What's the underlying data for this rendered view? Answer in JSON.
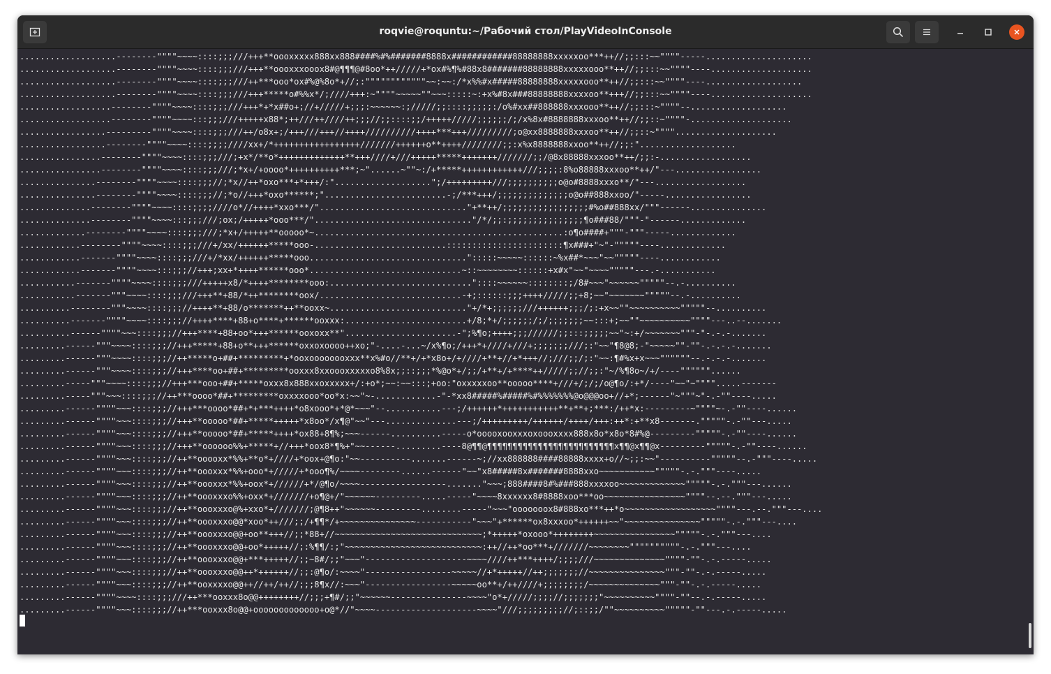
{
  "window": {
    "title": "roqvie@roquntu:~/Рабочий стол/PlayVideoInConsole"
  },
  "titlebar": {
    "new_tab_icon": "new-tab-icon",
    "search_icon": "search-icon",
    "menu_icon": "hamburger-menu-icon",
    "minimize_icon": "minimize-icon",
    "maximize_icon": "maximize-icon",
    "close_icon": "close-icon"
  },
  "colors": {
    "terminal_bg": "#2d2b33",
    "titlebar_bg": "#2b2b2b",
    "text": "#e9e9e9",
    "close_accent": "#e95420"
  },
  "terminal": {
    "lines": [
      "...................--------\"\"\"\"~~~~::::;;;///+++**oooxxxxx888xx888####%#%#######8888x############88888888xxxxxoo***++//;;:::~~\"\"\"\"-----.....................",
      "...................--------\"\"\"\"~~~~::::;;;///+++**oooxxxooox8#@¶¶¶@#8oo*++/////+*ox#%¶%#88x8#######88888888xxxxxooo**++//;;:::~~\"\"\"\"----....................",
      "...................--------\"\"\"\"~~~~::::;;;///++***ooo*ox#%@%8o*+//;:\"\"\"\"\"\"\"\"\"\"\"\"~~:~~:/*x%%#x#####88888888xxxxxooo**++//;;:::~~\"\"\"\"----...................",
      "...................--------\"\"\"\"~~~~::::;;;///+++*****o#%%x*/;////+++:~\"\"\"\"~~~~~\"\"~~~:::::~:+x%#8x###88888888xxxxoo**+++//;;:::~~\"\"\"\"----....................",
      "..................--------\"\"\"\"~~~~::::;;;///+++*+*x##o+;//+/////+;;;:~~~~~~:;/////;;::::;;;;;:/o%#xx##888888xxxooo**++//;;:::~\"\"\"\"--...................",
      "..................--------\"\"\"\"~~~~:::;;;///+++++x88*;++///++////++;;;//;;::::;;/+++++/////;;;;;;/;/x%8x#8888888xxxoo**++//;;::~\"\"\"\"-....................",
      ".................---------\"\"\"\"~~~~::::;;;///++/o8x+;/+++///+++//++++//////////++++***+++/////////;o@xx8888888xxxoo**++//;;::~\"\"\"\"....................",
      ".................--------\"\"\"\"~~~~::::;;;;////xx+/*+++++++++++++++++///////++++++o**++++////////;;:x%x8888888xxoo**++//;;:\"...................",
      "................--------\"\"\"\"~~~~::::;;;///;+x*/**o*+++++++++++++**+++////+///+++++*****+++++++///////;;/@8x88888xxxoo**++/;;:-..................",
      "................--------\"\"\"\"~~~~::::;;;///;*x+/+oooo*++++++++++***;~\"......~\"\"~:/+*****++++++++++++///;;;;:8%o88888xxxoo**++/\"---.................",
      "...............--------\"\"\"\"~~~~::::;;;//;*x//++*oxo***+*+++/:\"...................\";/+++++++++///;;;;;;;;;;o@o#8888xxxo**/\"---..................",
      "...............--------\"\"\"\"~~~~::::;;;//;*o//+++*oxo******;\"........................-;/***+++/;;;;;;;;;;;;;;o@o##888xxoo/\"-----.................",
      "..............--------\"\"\"\"~~~~::::;;;;////o*//++++*xxo***/\".............................\"+**++/;;;;;;;;;;;;;;;;;#%o##888xx/\"\"\"------...............",
      "..............--------\"\"\"\"~~~~:::;;;///;ox;/+++++*ooo***/\"...............................\"/*/;;:;;;;;;;;;;;;;;;¶o###88/\"\"\"-\"------.............",
      ".............--------\"\"\"\"~~~~::::;;;///;*x+/+++++**ooooo*~.................................................:o¶o####+\"\"\"-\"\"\"-----.............",
      "............--------\"\"\"\"~~~~::::;;;///+/xx/++++++*****ooo-..........................:::::::::::::::::::::::¶x###+\"~\"-\"\"\"\"\"----.............",
      "............-------\"\"\"\"~~~~::::;;;///+/*xx/++++++*****ooo...............................\":::::~~~~~::::::~%x##*~~~\"~~\"\"\"\"\"----............",
      "............-------\"\"\"\"~~~~:::;;;//+++;xx+*++++******ooo*..............................~::~~~~~~~~::::::+x#x\"~~\"~~~~\"\"\"\"\"---.-...........",
      "...........-------\"\"\"\"~~~~::::;;;///+++++x8/*++++********ooo:............................\"::::~~~~~~::::::::;/8#~~~\"~~~~~~\"\"\"\"\"--.-..........",
      "...........-------\"\"\"~~~~::::;;;///+++**+88/*++********oox/............................-+;::::::;;;++++/////;;+8;~~\"~~~~~~~\"\"\"\"\"--.-..........",
      "..........--------\"\"\"~~~~::::;;;//++++**+88/o*******++**ooxx~...........................\"+/*+;;;;;;///++++++;;;/;:+x~~\"\"~~~~~~~~~~\"\"\"\"\"--..........",
      "..........-------\"\"\"\"~~~~::::;;;//++++****+88+o****+******ooxxx:........................+/8;*+/;;;;;;/;/;;;;;;;~~:::+;~~\"\"~~~~~~~~~~\"\"\"\"---..--.......",
      "..........------\"\"\"\"~~~::::;;;//+++****+88+oo*+++******ooxoxx**\"......................-\";%¶o;++++;;;//////;;:::;;;;;~~\"~:+/~~~~~~~\"\"\"-\"-.-.-.......",
      ".........------\"\"\"~~~~::::;;;//+++*****+88+o**+++******oxxoxoooo++xo;\"-....-...~/x%¶o;/+++*+////+///+;;;;;;;///;:\"~~\"¶8@8;-\"~~~~~\"\"-\"\"-.-.-.-.......",
      ".........------\"\"\"~~~~::::;;;//++*****o+##+*********+*ooxoooooooxxx**x%#o//**+/+*x8o+/+////+**+//+*+++//;///;;/;:\"~~:¶#%x+x~~~\"\"\"\"\"\"--.-.-.-.......",
      ".........------\"\"\"~~~~::::;;;//+++****oo+##+*********ooxxx8xxoooxxxxxo8%8x;;::;;;*%@o*+/;;/+**+/+****++/////;;//;;:\"~/%¶8o~/+/----\"\"\"\"\"\"......",
      ".........-----\"\"\"~~~~::::;;;//+++***ooo+##+*****oxxx8x888xxoxxxxx+/:+o*;~~:~~:::;+oo:\"oxxxxxoo**ooooo****+///+/;/;/o@¶o/:+*/----\"~~\"~\"\"\"\".....-------",
      ".........-----\"\"\"~~~::::;;;//++***oooo*##+*********oxxxxooo*oo*x:~~\"~-............-\"-*xx8#####%#####%#%%%%%%%@o@@@oo+//+*;------\"~\"\"\"~\"-.-\"\"----.....",
      ".........------\"\"\"\"~~~::::;;;//+++***oooo*##+*+***++++*o8xooo*+*@*~~~\"--...........---;/++++++*+++++++++++**+**+;***:/++*x:---------~\"\"\"\"~-.-\"\"----......",
      ".........------\"\"\"\"~~~::::;;;//+++**ooooo*##+*****+++++*x8oo*/x¶@\"~~\"---..............---;/+++++++++/++++++/++++/+++:++*:+**x8-------.\"\"\"\"\"-.-\"\"---.....",
      ".........------\"\"\"\"~~~::::;;;//+++**ooooo*##+*****++++*ox88+8¶%;~~~------..........-----o*ooooxooxxxoxoooxxxx888x8o*x8o*8#%@---------\"\"\"\"\"-.-\"\"----......",
      ".........------\"\"\"\"~~~::::;;;//+++**oooooo%%+*****+//+++*oox8*¶%+\"~~------.........----8@¶¶@¶¶¶¶¶¶¶¶¶¶¶¶¶¶¶¶¶¶¶¶¶¶¶¶¶x¶¶@x¶¶@x---------\"\"\"\"\"-.-\"\"----......",
      ".........------\"\"\"\"~~~::::;;;//++**ooooxx*%%+**o*+////+*oox+@¶o:\"~~----------.......------~;//xx888888####88888xxxx+o//~;;:~~\"----------\"\"\"\"\"--.-\"\"\"----.....",
      ".........------\"\"\"\"~~~::::;;;//++**oooxxx*%%+ooo*+/////+*ooo¶%/~~~~--------......------\"~~\"x8#####8x#######8888xxo~~~~~~~~~~~\"\"\"\"\"-.-.\"\"\"----.....",
      ".........------\"\"\"\"~~~::::;;;//++**oooxxx*%%+oox*+//////+*/@¶o/~~~~-----------------.......\"~~~;888####8#%###888xxxxoo~~~~~~~~~~~~~\"\"\"\"\"-.-.\"\"\"---......",
      ".........------\"\"\"\"~~~::::;;;//++**oooxxxo%%+oxx*+///////+o¶@+/\"~~~~~~---------.....-----\"~~~~8xxxxxx8#8888xoo***oo~~~~~~~~~~~~~~~~\"\"\"\"--.--.\"\"\"---.....",
      ".........------\"\"\"\"~~~::::;;;//++**oooxxxo@%+xxo*+///////;@¶8++\"~~~~~~---------........-----\"~~~\"ooooooox8#888xo***++*o~~~~~~~~~~~~~~~~~~\"\"\"\"---.--.\"\"\"---....",
      ".........------\"\"\"\"~~~::::;;;//++**oooxxxo@@*xoo*++///;;/+¶¶*/+~~~~~~~~~~~~~~~-----------\"~~~\"+******ox8xxxoo*++++++~~\"~~~~~~~~~~~~~~~\"\"\"\"\"-.-.\"\"\"---....",
      ".........------\"\"\"\"~~~::::;;;//++**oooxxxo@@+oo**+++//;;*88+//~~~~~~~~~~~~~~~~~~~~~~~~~~~~~;*+++++*oxooo*++++++++~~~~~~~~~~~~~~~~\"\"\"\"\"-.-.\"\"\"---....",
      ".........------\"\"\"\"~~~::::;;;//++**oooxxxo@@+oo*+++++//;:%¶¶/:;\"~~~~~~~~~~~~~~~~~~~~~~~~~~~:++//++*oo***+///////~~~~~~~~\"\"\"\"\"\"\"\"\"\"-.-.\"\"\"---....",
      ".........------\"\"\"\"~~~::::;;;//++**oooxxxo@@+***+++++//;;~8#/;;\"~~~\"--------------------~~~~////++***++++/;;;;///~~~~~~~~~~~~~~\"\"\"\"-\"\"-.-.-----.....",
      ".........------\"\"\"\"~~~::::;;;//++**oooxxxo@@++*++++++//;;:@¶o/:~~~~\"-----------------~~~~~//+*+++++//++;;;;;;;//~~~~~~~~~~~~~~~\"\"\"-\"\"-.-.-----.....",
      ".........------\"\"\"\"~~~::::;;;//++**ooxxxxo@@++//++/++//;;;8¶x//:~~~\"-----------------~~~~~oo**+/++////+;;;;;;;;/~~~~~~~~~~~~~~\"\"\"-\"\"-.-.-----.....",
      ".........------\"\"\"\"~~~~::::;;;///++***ooxxx8o@@++++++++//;;;+¶#/;;\"~~~~~~---------------~~~~\"o*+/////;;;;//;;;;;;;\"~~~~~~~~~~\"\"\"\"-\"\"--.-.-----.....",
      ".........------\"\"\"\"~~~::::;;;//++***ooxxx8o@@+ooooooooooooo+o@*//\"~~~~--------------------~~~~\"///;;;;;;;;;//;::;;/\"\"~~~~~~~~~~\"\"\"\"\"-\"\"---.-.-----....."
    ]
  }
}
